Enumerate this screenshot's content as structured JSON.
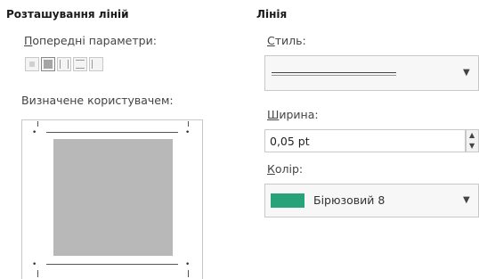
{
  "placement": {
    "title": "Розташування ліній",
    "presets_label": "Попередні параметри:",
    "presets_underline": "П",
    "presets_rest": "опередні параметри:",
    "user_defined_label": "Визначене користувачем:"
  },
  "line": {
    "title": "Лінія",
    "style_label_u": "С",
    "style_label_rest": "тиль:",
    "width_label_u": "Ш",
    "width_label_rest": "ирина:",
    "width_value": "0,05 pt",
    "color_label_u": "К",
    "color_label_rest": "олір:",
    "color_value": "Бірюзовий 8",
    "color_hex": "#27a37a"
  },
  "icons": [
    "chevron-down-icon",
    "spinner-up-icon",
    "spinner-down-icon"
  ]
}
